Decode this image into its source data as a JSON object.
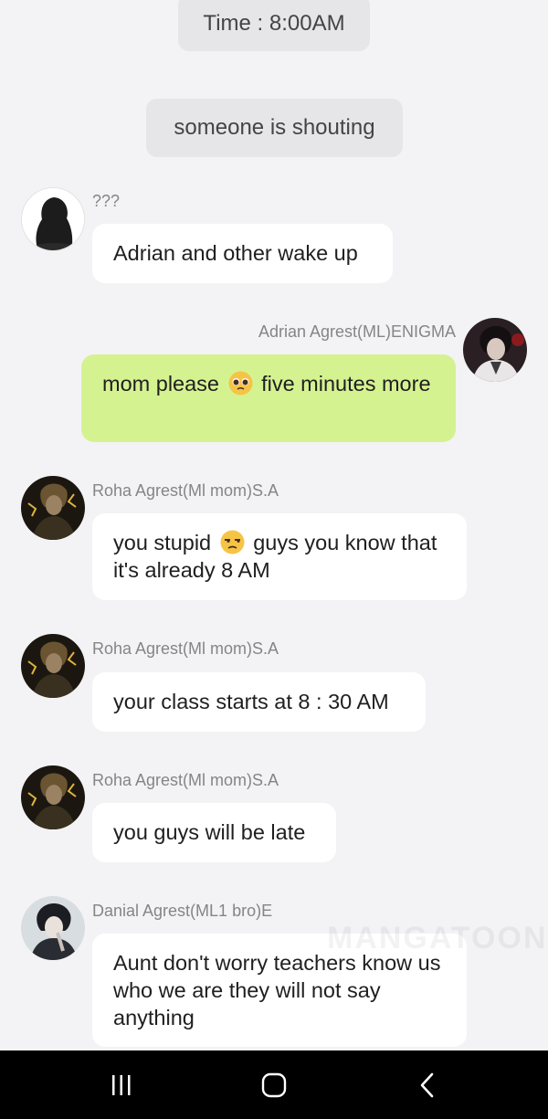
{
  "chat": {
    "time_label": "Time : 8:00AM",
    "notice": "someone is shouting",
    "messages": [
      {
        "sender": "???",
        "text": "Adrian and other wake up",
        "avatar": "silhouette-avatar",
        "side": "left"
      },
      {
        "sender": "Adrian Agrest(ML)ENIGMA",
        "text_before": "mom please",
        "emoji": "pleading-face-emoji",
        "text_after": "five minutes more",
        "avatar": "adrian-avatar",
        "side": "right"
      },
      {
        "sender": "Roha Agrest(Ml mom)S.A",
        "text_before": "you stupid",
        "emoji": "unamused-face-emoji",
        "text_after": "guys you know that it's already 8 AM",
        "avatar": "roha-avatar",
        "side": "left"
      },
      {
        "sender": "Roha Agrest(Ml mom)S.A",
        "text": "your class starts at 8 : 30 AM",
        "avatar": "roha-avatar",
        "side": "left"
      },
      {
        "sender": "Roha Agrest(Ml mom)S.A",
        "text": "you guys will be late",
        "avatar": "roha-avatar",
        "side": "left"
      },
      {
        "sender": "Danial Agrest(ML1 bro)E",
        "text": "Aunt don't worry teachers know us who we are they will not say anything",
        "avatar": "danial-avatar",
        "side": "left"
      }
    ]
  },
  "watermark": "MANGATOON",
  "navbar": {
    "recent": "recent-apps-icon",
    "home": "home-icon",
    "back": "back-icon"
  },
  "colors": {
    "background": "#f3f3f5",
    "my_bubble": "#d5f291",
    "other_bubble": "#ffffff",
    "system_pill": "#e6e6e8",
    "sender_text": "#858585"
  }
}
